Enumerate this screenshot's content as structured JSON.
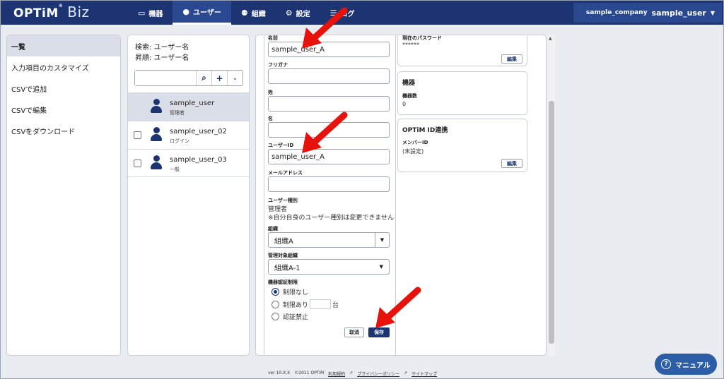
{
  "header": {
    "logo": "OPTiM",
    "logo_product": "Biz",
    "nav": [
      {
        "label": "機器",
        "icon": "device-icon"
      },
      {
        "label": "ユーザー",
        "icon": "user-icon"
      },
      {
        "label": "組織",
        "icon": "organization-icon"
      },
      {
        "label": "設定",
        "icon": "gear-icon"
      },
      {
        "label": "ログ",
        "icon": "log-icon"
      }
    ],
    "company": "sample_company",
    "user": "sample_user"
  },
  "sidebar": {
    "items": [
      {
        "label": "一覧"
      },
      {
        "label": "入力項目のカスタマイズ"
      },
      {
        "label": "CSVで追加"
      },
      {
        "label": "CSVで編集"
      },
      {
        "label": "CSVをダウンロード"
      }
    ]
  },
  "user_panel": {
    "search_label": "検索: ユーザー名",
    "sort_label": "昇順: ユーザー名",
    "search_value": "",
    "users": [
      {
        "name": "sample_user",
        "role": "管理者"
      },
      {
        "name": "sample_user_02",
        "role": "ログイン"
      },
      {
        "name": "sample_user_03",
        "role": "一般"
      }
    ]
  },
  "form": {
    "name_label": "名前",
    "name_value": "sample_user_A",
    "furigana_label": "フリガナ",
    "furigana_value": "",
    "last_name_label": "姓",
    "last_name_value": "",
    "first_name_label": "名",
    "first_name_value": "",
    "user_id_label": "ユーザーID",
    "user_id_value": "sample_user_A",
    "email_label": "メールアドレス",
    "email_value": "",
    "user_type_label": "ユーザー種別",
    "user_type_value": "管理者",
    "user_type_note": "※自分自身のユーザー種別は変更できません",
    "org_label": "組織",
    "org_value": "組織A",
    "managed_org_label": "管理対象組織",
    "managed_org_value": "組織A-1",
    "device_limit_label": "機器認証制限",
    "radio_no_limit": "制限なし",
    "radio_limit": "制限あり",
    "radio_limit_unit": "台",
    "radio_deny": "認証禁止",
    "cancel_label": "取消",
    "save_label": "保存"
  },
  "cards": {
    "password_label": "現在のパスワード",
    "password_value": "******",
    "edit_label": "編集",
    "device_title": "機器",
    "device_count_label": "機器数",
    "device_count_value": "0",
    "optim_id_title": "OPTiM ID連携",
    "member_id_label": "メンバーID",
    "member_id_value": "(未設定)"
  },
  "footer": {
    "version": "ver 10.X.X",
    "copyright": "©2011 OPTiM",
    "terms": "利用規約",
    "privacy": "プライバシーポリシー",
    "sitemap": "サイトマップ"
  },
  "manual_label": "マニュアル",
  "colors": {
    "brand": "#1d3472",
    "accent": "#2c5ea8",
    "annotation_arrow": "#e8120c"
  }
}
